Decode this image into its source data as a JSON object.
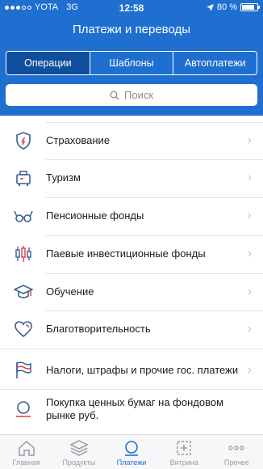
{
  "status_bar": {
    "carrier": "YOTA",
    "network": "3G",
    "time": "12:58",
    "battery": "80 %"
  },
  "header": {
    "title": "Платежи и переводы"
  },
  "segments": [
    {
      "label": "Операции",
      "active": true
    },
    {
      "label": "Шаблоны",
      "active": false
    },
    {
      "label": "Автоплатежи",
      "active": false
    }
  ],
  "search": {
    "placeholder": "Поиск"
  },
  "list": {
    "items": [
      {
        "label": "Страхование",
        "icon": "shield-icon"
      },
      {
        "label": "Туризм",
        "icon": "suitcase-icon"
      },
      {
        "label": "Пенсионные фонды",
        "icon": "glasses-icon"
      },
      {
        "label": "Паевые инвестиционные фонды",
        "icon": "candlestick-icon"
      },
      {
        "label": "Обучение",
        "icon": "graduation-cap-icon"
      },
      {
        "label": "Благотворительность",
        "icon": "heart-icon"
      },
      {
        "label": "Налоги, штрафы и прочие гос. платежи",
        "icon": "flag-icon"
      },
      {
        "label": "Покупка ценных бумаг на фондовом рынке руб.",
        "icon": "circle-icon"
      }
    ]
  },
  "tabbar": {
    "items": [
      {
        "label": "Главная",
        "icon": "home-icon"
      },
      {
        "label": "Продукты",
        "icon": "layers-icon"
      },
      {
        "label": "Платежи",
        "icon": "payments-icon"
      },
      {
        "label": "Витрина",
        "icon": "showcase-icon"
      },
      {
        "label": "Прочее",
        "icon": "more-icon"
      }
    ]
  },
  "colors": {
    "brand_blue": "#1f6fd1",
    "active_segment": "#0f4e9d",
    "icon_blue": "#3a5f95",
    "icon_red": "#e23b3b"
  }
}
